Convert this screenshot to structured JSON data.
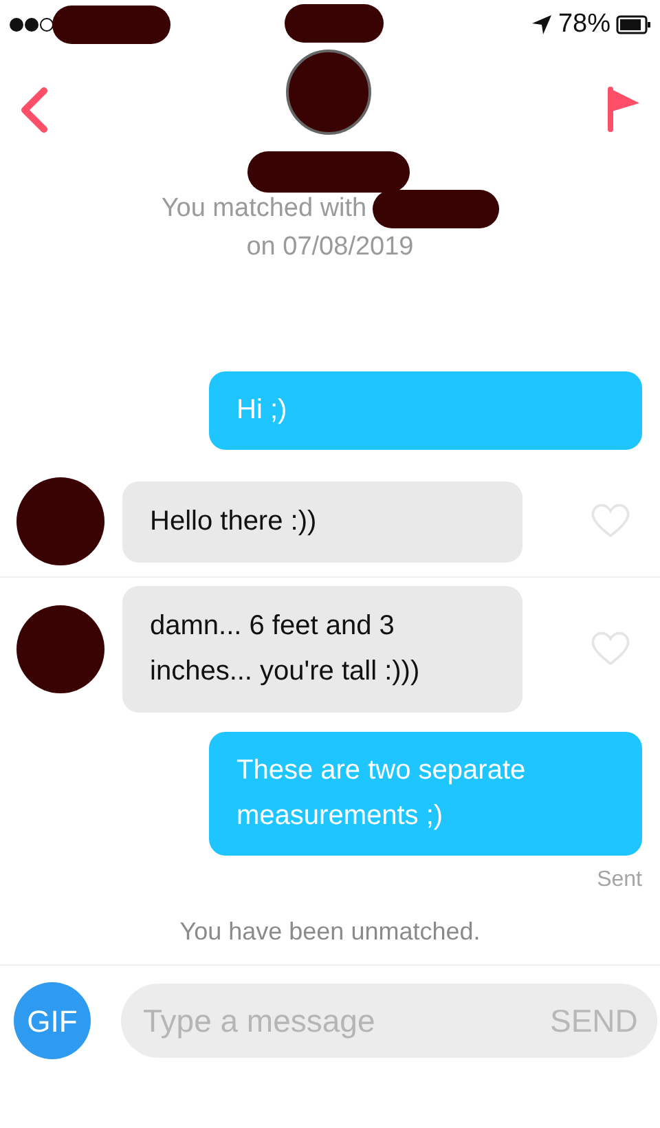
{
  "status_bar": {
    "battery": "78%"
  },
  "match_info": {
    "line_1": "You matched with",
    "line_2": "on 07/08/2019"
  },
  "messages": [
    {
      "kind": "sent",
      "text": "Hi ;)"
    },
    {
      "kind": "received",
      "text": "Hello there :))",
      "liked": false
    },
    {
      "kind": "received",
      "text": "damn... 6 feet and 3 inches... you're tall :)))",
      "liked": false
    },
    {
      "kind": "sent",
      "text": "These are two separate measurements ;)"
    }
  ],
  "sent_status": "Sent",
  "system_notice": "You have been unmatched.",
  "composer": {
    "gif_button": "GIF",
    "placeholder": "Type a message",
    "send_button": "SEND"
  }
}
